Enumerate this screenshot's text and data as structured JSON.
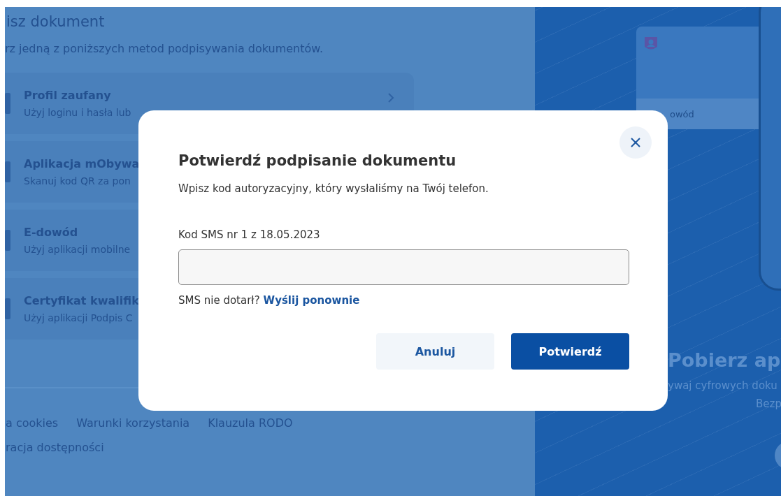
{
  "background_page": {
    "heading": "isz dokument",
    "subtitle": "rz jedną z poniższych metod podpisywania dokumentów.",
    "methods": [
      {
        "title": "Profil zaufany",
        "description": "Użyj loginu i hasła lub",
        "chevron": true
      },
      {
        "title": "Aplikacja mObywa",
        "description": "Skanuj kod QR za pon"
      },
      {
        "title": "E-dowód",
        "description": "Użyj aplikacji mobilne"
      },
      {
        "title": "Certyfikat kwalifik",
        "description": "Użyj aplikacji Podpis C"
      }
    ],
    "footer_links": [
      [
        "a cookies",
        "Warunki korzystania",
        "Klauzula RODO"
      ],
      [
        "racja dostępności"
      ]
    ]
  },
  "promo_panel": {
    "card_label": "owód",
    "heading": "Pobierz ap",
    "text_lines": [
      "ywaj cyfrowych doku",
      "Bezp"
    ]
  },
  "dialog": {
    "title": "Potwierdź podpisanie dokumentu",
    "description": "Wpisz kod autoryzacyjny, który wysłaliśmy na Twój telefon.",
    "field_label": "Kod SMS nr 1 z 18.05.2023",
    "resend_question": "SMS nie dotarł?",
    "resend_link": "Wyślij ponownie",
    "buttons": [
      {
        "label": "Anuluj",
        "kind": "secondary"
      },
      {
        "label": "Potwierdź",
        "kind": "primary"
      }
    ]
  }
}
